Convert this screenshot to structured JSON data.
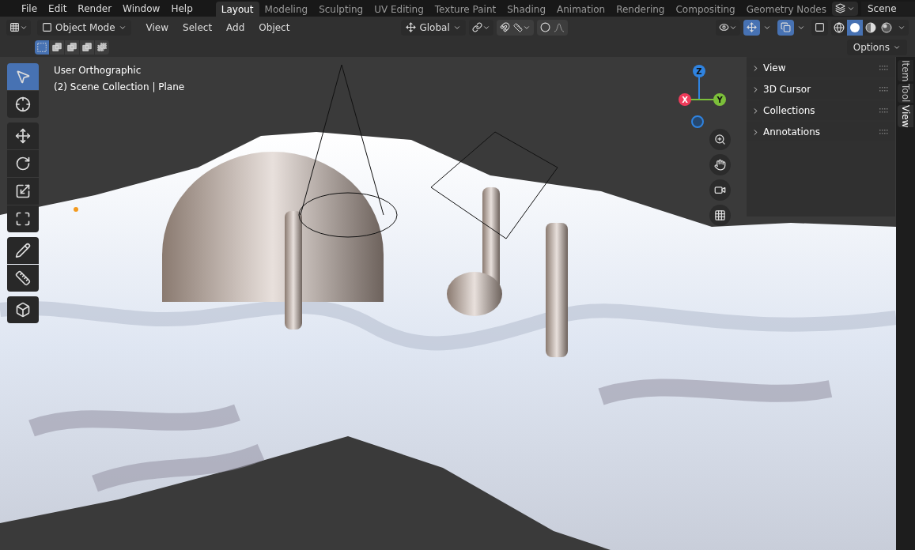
{
  "topbar": {
    "menus": [
      "File",
      "Edit",
      "Render",
      "Window",
      "Help"
    ],
    "workspaces": [
      {
        "label": "Layout",
        "selected": true
      },
      {
        "label": "Modeling",
        "selected": false
      },
      {
        "label": "Sculpting",
        "selected": false
      },
      {
        "label": "UV Editing",
        "selected": false
      },
      {
        "label": "Texture Paint",
        "selected": false
      },
      {
        "label": "Shading",
        "selected": false
      },
      {
        "label": "Animation",
        "selected": false
      },
      {
        "label": "Rendering",
        "selected": false
      },
      {
        "label": "Compositing",
        "selected": false
      },
      {
        "label": "Geometry Nodes",
        "selected": false
      }
    ],
    "scene": "Scene"
  },
  "header": {
    "mode": "Object Mode",
    "menus": [
      "View",
      "Select",
      "Add",
      "Object"
    ],
    "orientation": "Global",
    "snap_on": false,
    "proportional_on": false,
    "show_gizmos_on": true,
    "overlays_on": true,
    "xray_on": false,
    "shading_modes": [
      {
        "kind": "wireframe",
        "selected": false
      },
      {
        "kind": "solid",
        "selected": true
      },
      {
        "kind": "material",
        "selected": false
      },
      {
        "kind": "rendered",
        "selected": false
      }
    ],
    "selection_modes": [
      {
        "kind": "new",
        "selected": true
      },
      {
        "kind": "extend",
        "selected": false
      },
      {
        "kind": "subtract",
        "selected": false
      },
      {
        "kind": "invert",
        "selected": false
      },
      {
        "kind": "intersect",
        "selected": false
      }
    ],
    "options": "Options"
  },
  "viewport": {
    "info": [
      "User Orthographic",
      "(2) Scene Collection | Plane"
    ],
    "tools": [
      {
        "kind": "select",
        "selected": true
      },
      {
        "kind": "cursor",
        "selected": false
      },
      {
        "kind": "move",
        "selected": false
      },
      {
        "kind": "rotate",
        "selected": false
      },
      {
        "kind": "scale",
        "selected": false
      },
      {
        "kind": "transform",
        "selected": false
      },
      {
        "kind": "annotate",
        "selected": false
      },
      {
        "kind": "measure",
        "selected": false
      },
      {
        "kind": "add-cube",
        "selected": false
      }
    ],
    "axes": [
      "Z",
      "X",
      "Y"
    ]
  },
  "sidebar": {
    "panels": [
      {
        "label": "View",
        "expanded": false
      },
      {
        "label": "3D Cursor",
        "expanded": false
      },
      {
        "label": "Collections",
        "expanded": false
      },
      {
        "label": "Annotations",
        "expanded": false
      }
    ],
    "tabs": [
      {
        "label": "Item",
        "selected": false
      },
      {
        "label": "Tool",
        "selected": false
      },
      {
        "label": "View",
        "selected": true
      }
    ]
  }
}
